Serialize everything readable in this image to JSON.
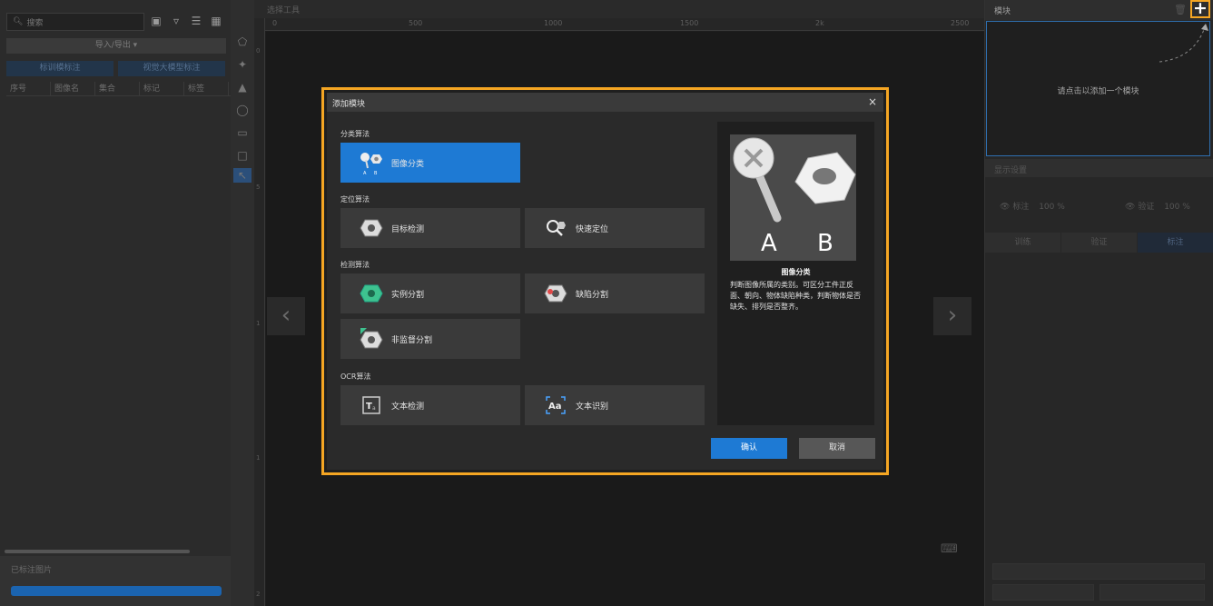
{
  "left_panel": {
    "search_placeholder": "搜索",
    "import_export_label": "导入/导出 ▾",
    "btn_left": "标训模标注",
    "btn_right": "视觉大模型标注",
    "columns": [
      "序号",
      "图像名",
      "集合",
      "标记",
      "标签"
    ],
    "bottom_label": "已标注图片"
  },
  "canvas": {
    "title": "选择工具",
    "ruler_h": [
      "0",
      "500",
      "1000",
      "1500",
      "2k",
      "2500"
    ],
    "ruler_v": [
      "0",
      "5",
      "1",
      "1",
      "2"
    ]
  },
  "right_panel": {
    "title": "模块",
    "hint": "请点击以添加一个模块",
    "display_settings": "显示设置",
    "visibility": [
      {
        "label": "标注",
        "value": "100 %"
      },
      {
        "label": "验证",
        "value": "100 %"
      }
    ],
    "tabs": [
      "训练",
      "验证",
      "标注"
    ]
  },
  "modal": {
    "title": "添加模块",
    "close": "×",
    "categories": [
      {
        "name": "分类算法",
        "items": [
          {
            "label": "图像分类",
            "icon": "image-classification-icon",
            "selected": true
          }
        ]
      },
      {
        "name": "定位算法",
        "items": [
          {
            "label": "目标检测",
            "icon": "object-detection-icon"
          },
          {
            "label": "快速定位",
            "icon": "fast-positioning-icon"
          }
        ]
      },
      {
        "name": "检测算法",
        "items": [
          {
            "label": "实例分割",
            "icon": "instance-segmentation-icon"
          },
          {
            "label": "缺陷分割",
            "icon": "defect-segmentation-icon"
          },
          {
            "label": "非监督分割",
            "icon": "unsupervised-segmentation-icon"
          }
        ]
      },
      {
        "name": "OCR算法",
        "items": [
          {
            "label": "文本检测",
            "icon": "text-detection-icon"
          },
          {
            "label": "文本识别",
            "icon": "text-recognition-icon"
          }
        ]
      }
    ],
    "preview": {
      "letter_a": "A",
      "letter_b": "B",
      "name": "图像分类",
      "description": "判断图像所属的类别。可区分工件正反面、朝向、物体缺陷种类，判断物体是否缺失、排列是否整齐。"
    },
    "ok": "确认",
    "cancel": "取消"
  },
  "colors": {
    "accent_blue": "#1e7ad4",
    "highlight_orange": "#f5a623"
  }
}
